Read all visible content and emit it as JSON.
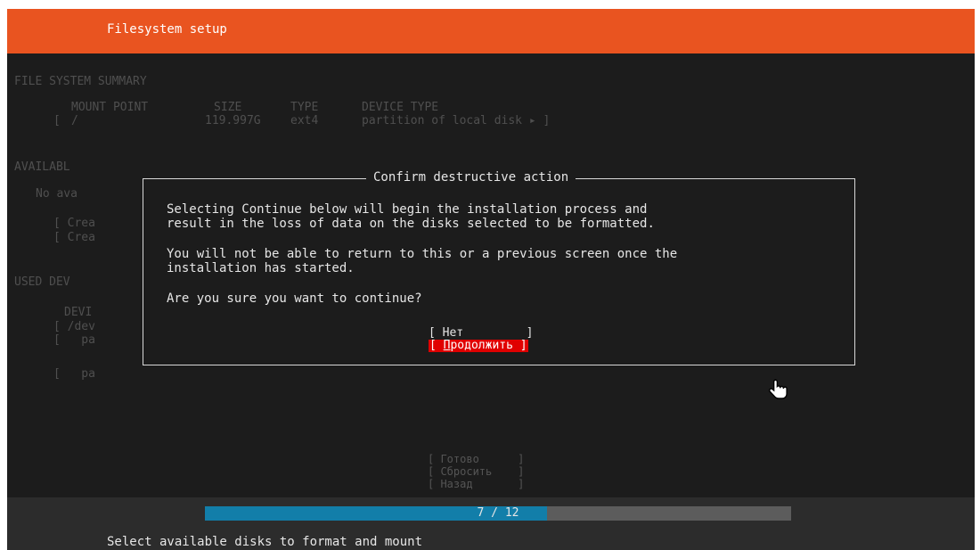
{
  "header": {
    "title": "Filesystem setup"
  },
  "background": {
    "summary_heading": "FILE SYSTEM SUMMARY",
    "columns": [
      "MOUNT POINT",
      "SIZE",
      "TYPE",
      "DEVICE TYPE"
    ],
    "row": {
      "open": "[",
      "mount": "/",
      "size": "119.997G",
      "type": "ext4",
      "device": "partition of local disk ▸ ]"
    },
    "available_heading": "AVAILABL",
    "no_available": "No ava",
    "create_1": "[ Crea",
    "create_2": "[ Crea",
    "used_heading": "USED DEV",
    "devi": "DEVI",
    "dev_row": "[ /dev",
    "pa_1": "[   pa",
    "pa_2": "[   pa"
  },
  "dialog": {
    "title": "Confirm destructive action",
    "paragraph1": "Selecting Continue below will begin the installation process and\nresult in the loss of data on the disks selected to be formatted.",
    "paragraph2": "You will not be able to return to this or a previous screen once the\ninstallation has started.",
    "question": "Are you sure you want to continue?",
    "no_button": "[ Нет         ]",
    "continue_prefix": "[ ",
    "continue_hotkey": "П",
    "continue_rest": "родолжить ]"
  },
  "bottom_buttons": {
    "done": "[ Готово      ]",
    "reset": "[ Сбросить    ]",
    "back": "[ Назад       ]"
  },
  "footer": {
    "progress_text": "7 / 12",
    "progress_current": 7,
    "progress_total": 12,
    "status": "Select available disks to format and mount"
  },
  "colors": {
    "accent": "#e95420",
    "progress": "#127ea9",
    "danger": "#e00000"
  },
  "icons": {
    "cursor": "hand-pointer-icon"
  }
}
